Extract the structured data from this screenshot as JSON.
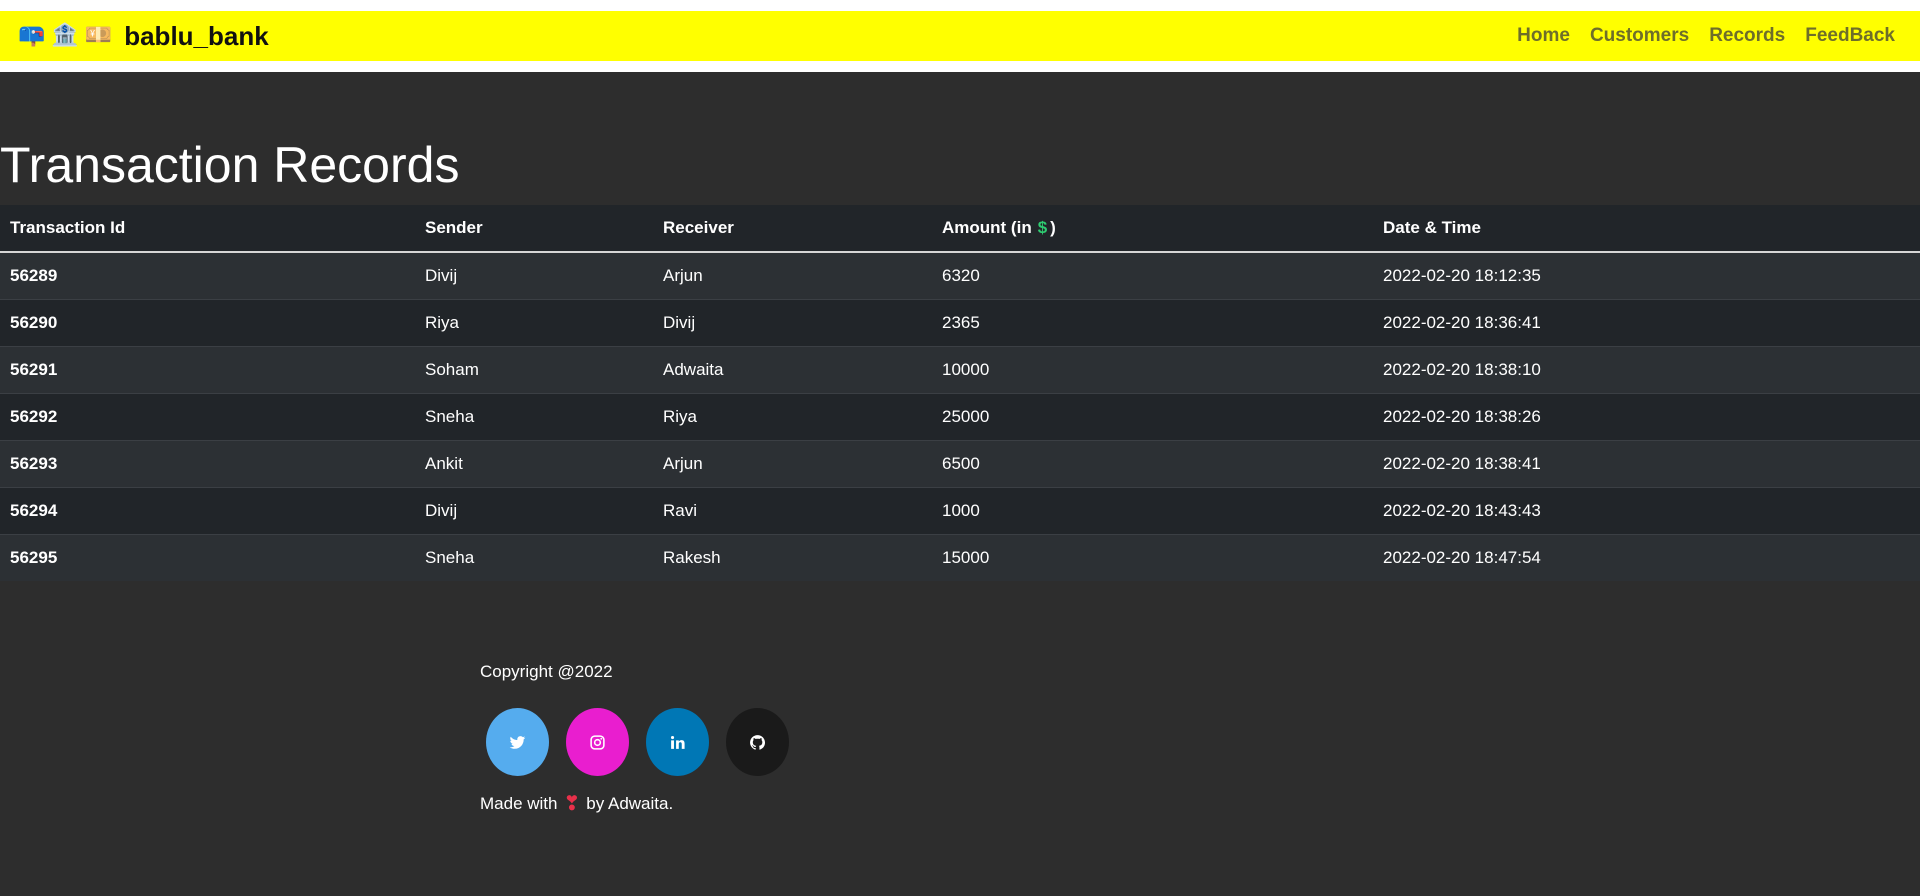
{
  "navbar": {
    "brand_emoji_1": "📪",
    "brand_emoji_2": "🏦",
    "brand_emoji_3": "💴",
    "brand_name": "bablu_bank",
    "links": [
      "Home",
      "Customers",
      "Records",
      "FeedBack"
    ]
  },
  "page": {
    "title": "Transaction Records"
  },
  "table": {
    "headers": {
      "id": "Transaction Id",
      "sender": "Sender",
      "receiver": "Receiver",
      "amount": "Amount (in",
      "amount_symbol": "$",
      "amount_close": ")",
      "datetime": "Date & Time"
    },
    "rows": [
      {
        "id": "56289",
        "sender": "Divij",
        "receiver": "Arjun",
        "amount": "6320",
        "datetime": "2022-02-20 18:12:35"
      },
      {
        "id": "56290",
        "sender": "Riya",
        "receiver": "Divij",
        "amount": "2365",
        "datetime": "2022-02-20 18:36:41"
      },
      {
        "id": "56291",
        "sender": "Soham",
        "receiver": "Adwaita",
        "amount": "10000",
        "datetime": "2022-02-20 18:38:10"
      },
      {
        "id": "56292",
        "sender": "Sneha",
        "receiver": "Riya",
        "amount": "25000",
        "datetime": "2022-02-20 18:38:26"
      },
      {
        "id": "56293",
        "sender": "Ankit",
        "receiver": "Arjun",
        "amount": "6500",
        "datetime": "2022-02-20 18:38:41"
      },
      {
        "id": "56294",
        "sender": "Divij",
        "receiver": "Ravi",
        "amount": "1000",
        "datetime": "2022-02-20 18:43:43"
      },
      {
        "id": "56295",
        "sender": "Sneha",
        "receiver": "Rakesh",
        "amount": "15000",
        "datetime": "2022-02-20 18:47:54"
      }
    ]
  },
  "footer": {
    "copyright": "Copyright @2022",
    "socials": [
      {
        "icon": "twitter-icon",
        "color": "#55acee"
      },
      {
        "icon": "instagram-icon",
        "color": "#e91ecf"
      },
      {
        "icon": "linkedin-icon",
        "color": "#0077b5"
      },
      {
        "icon": "github-icon",
        "color": "#1a1a1a"
      }
    ],
    "made_with_prefix": "Made with",
    "heart": "❣",
    "made_with_suffix": "by Adwaita."
  },
  "colors": {
    "navbar_bg": "#ffff00",
    "nav_link": "#6e6e2a",
    "page_bg": "#2d2d2d",
    "table_row_dark": "#212529",
    "table_row_light": "#2c3034",
    "dollar": "#2ecc71",
    "heart": "#e8304a"
  }
}
